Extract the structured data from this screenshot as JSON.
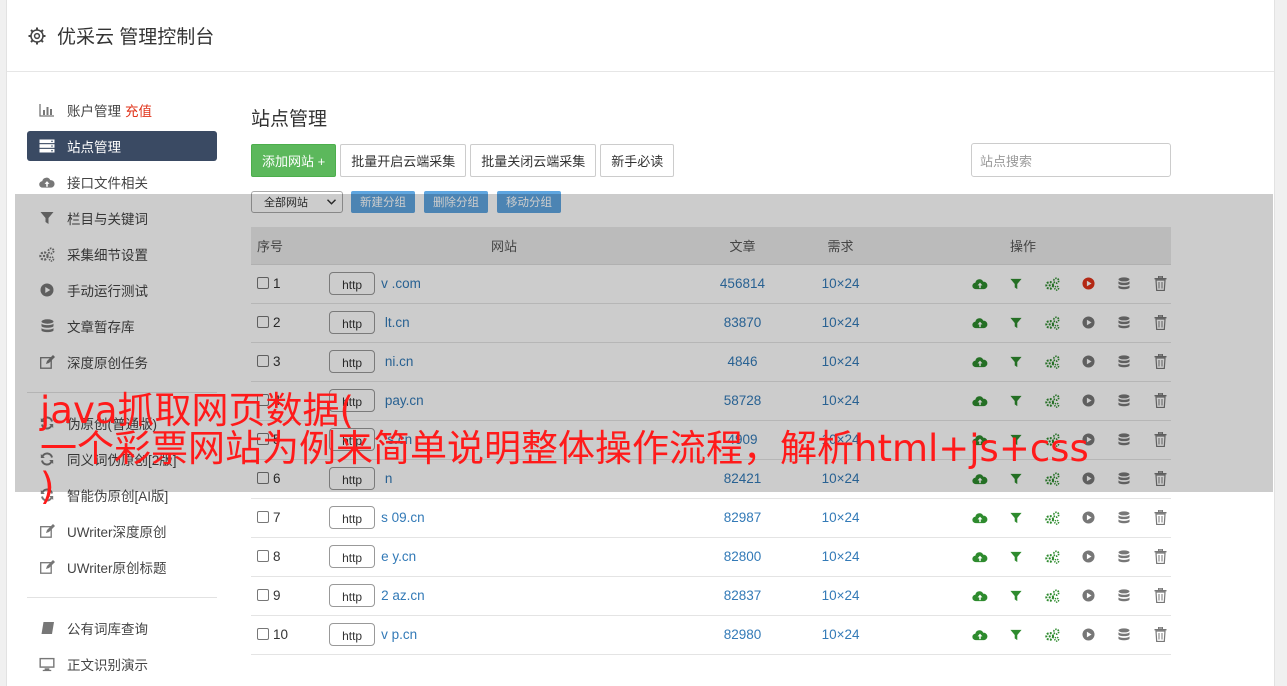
{
  "header": {
    "title": "优采云 管理控制台"
  },
  "sidebar": {
    "items": [
      {
        "label": "账户管理",
        "extra": "充值",
        "icon": "bar-chart-icon"
      },
      {
        "label": "站点管理",
        "icon": "server-icon",
        "active": true
      },
      {
        "label": "接口文件相关",
        "icon": "cloud-upload-icon"
      },
      {
        "label": "栏目与关键词",
        "icon": "filter-icon"
      },
      {
        "label": "采集细节设置",
        "icon": "gears-icon"
      },
      {
        "label": "手动运行测试",
        "icon": "play-circle-icon"
      },
      {
        "label": "文章暂存库",
        "icon": "database-icon"
      },
      {
        "label": "深度原创任务",
        "icon": "edit-icon"
      }
    ],
    "items2": [
      {
        "label": "伪原创(普通版)",
        "icon": "refresh-icon"
      },
      {
        "label": "同义词伪原创[2版]",
        "icon": "refresh-icon"
      },
      {
        "label": "智能伪原创[AI版]",
        "icon": "refresh-icon"
      },
      {
        "label": "UWriter深度原创",
        "icon": "edit-icon"
      },
      {
        "label": "UWriter原创标题",
        "icon": "edit-icon"
      }
    ],
    "items3": [
      {
        "label": "公有词库查询",
        "icon": "book-icon"
      },
      {
        "label": "正文识别演示",
        "icon": "monitor-icon"
      }
    ]
  },
  "main": {
    "title": "站点管理",
    "add_button": "添加网站 +",
    "batch_open": "批量开启云端采集",
    "batch_close": "批量关闭云端采集",
    "newbie": "新手必读",
    "search_placeholder": "站点搜索",
    "group_select": "全部网站",
    "new_group": "新建分组",
    "delete_group": "删除分组",
    "move_group": "移动分组"
  },
  "table": {
    "headers": {
      "no": "序号",
      "site": "网站",
      "articles": "文章",
      "demand": "需求",
      "ops": "操作"
    },
    "rows": [
      {
        "no": "1",
        "scheme": "http",
        "domain": "v        .com",
        "articles": "456814",
        "demand": "10×24",
        "running": true
      },
      {
        "no": "2",
        "scheme": "http",
        "domain": "      lt.cn",
        "articles": "83870",
        "demand": "10×24"
      },
      {
        "no": "3",
        "scheme": "http",
        "domain": "      ni.cn",
        "articles": "4846",
        "demand": "10×24"
      },
      {
        "no": "4",
        "scheme": "http",
        "domain": "      pay.cn",
        "articles": "58728",
        "demand": "10×24"
      },
      {
        "no": "5",
        "scheme": "http",
        "domain": "      's.cn",
        "articles": "4909",
        "demand": "10×24"
      },
      {
        "no": "6",
        "scheme": "http",
        "domain": "      n",
        "articles": "82421",
        "demand": "10×24"
      },
      {
        "no": "7",
        "scheme": "http",
        "domain": "s    09.cn",
        "articles": "82987",
        "demand": "10×24"
      },
      {
        "no": "8",
        "scheme": "http",
        "domain": "e     y.cn",
        "articles": "82800",
        "demand": "10×24"
      },
      {
        "no": "9",
        "scheme": "http",
        "domain": "2     az.cn",
        "articles": "82837",
        "demand": "10×24"
      },
      {
        "no": "10",
        "scheme": "http",
        "domain": "v    p.cn",
        "articles": "82980",
        "demand": "10×24"
      }
    ],
    "op_icons": [
      "cloud-upload-icon",
      "filter-icon",
      "gears-icon",
      "play-circle-icon",
      "database-icon",
      "trash-icon"
    ]
  },
  "overlay_caption": {
    "line1": "java抓取网页数据(",
    "line2": "一个彩票网站为例来简单说明整体操作流程，解析html+js+css",
    "line3": ")"
  },
  "colors": {
    "accent_green": "#5cb85c",
    "sidebar_active": "#3a4a63",
    "link_blue": "#337ab7",
    "caption_red": "#ff1a1a",
    "icon_green": "#2e8b2e",
    "running_red": "#e0331a"
  }
}
